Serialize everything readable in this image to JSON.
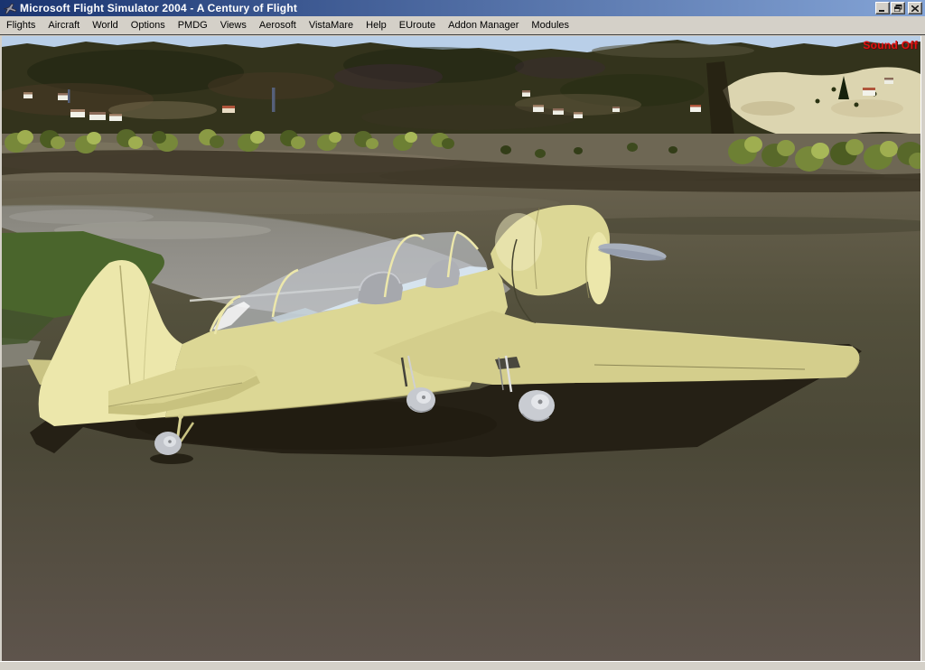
{
  "window": {
    "title": "Microsoft Flight Simulator 2004 - A Century of Flight"
  },
  "menu": {
    "items": [
      "Flights",
      "Aircraft",
      "World",
      "Options",
      "PMDG",
      "Views",
      "Aerosoft",
      "VistaMare",
      "Help",
      "EUroute",
      "Addon Manager",
      "Modules"
    ]
  },
  "viewport": {
    "sound_status": "Sound Off"
  },
  "theme": {
    "titlebar-left": "#1a3470",
    "titlebar-right": "#84a4d6",
    "chrome": "#d4d0c8",
    "menu-text": "#000000",
    "sound-off-red": "#e01212",
    "sky": "#b9cfe8",
    "hills": "#33331c",
    "cream-patch": "#dcd5b0",
    "field-top": "#68614e",
    "field-mid": "#4b4837",
    "field-bottom": "#5e544c",
    "taxiway": "#92908a",
    "grass-green": "#4a652c",
    "aircraft-yellow": "#dcd795",
    "aircraft-yellow-light": "#ece7ab",
    "aircraft-yellow-dark": "#c9c383",
    "canopy-glass": "#c6ccd4",
    "metal-gray": "#b3b7bd",
    "shadow": "#252015"
  }
}
